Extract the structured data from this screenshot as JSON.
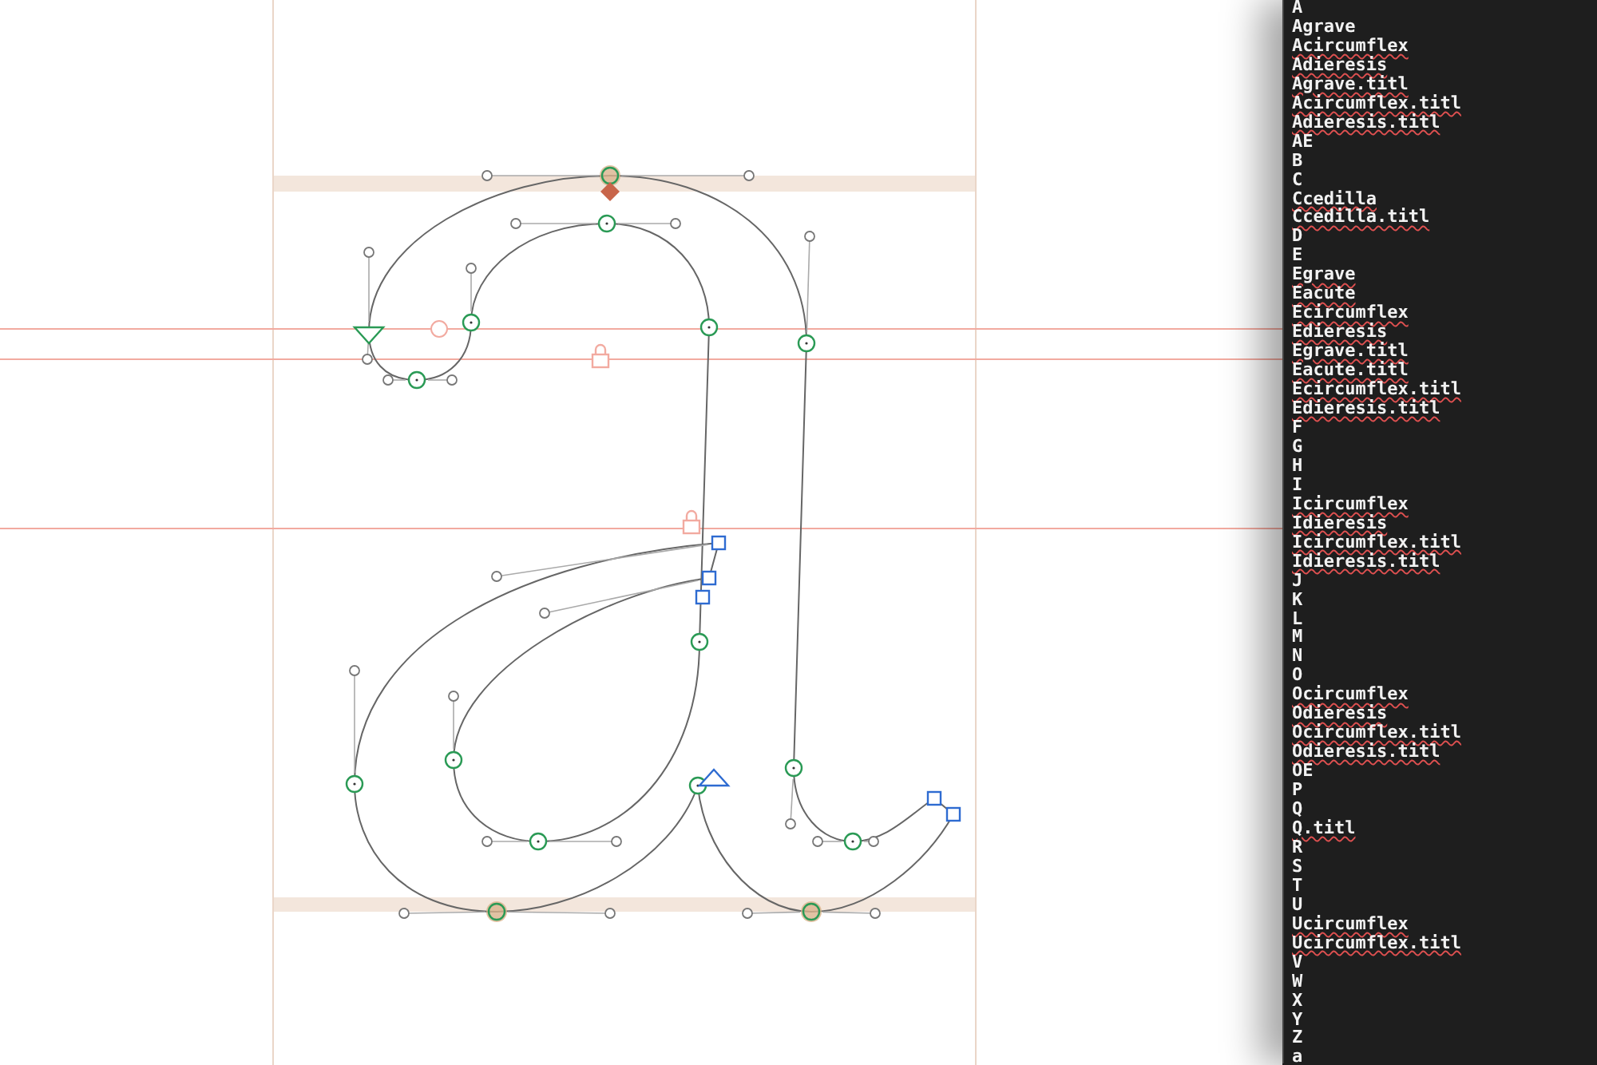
{
  "glyph_list": {
    "items": [
      {
        "name": "A",
        "flagged": false
      },
      {
        "name": "Agrave",
        "flagged": false
      },
      {
        "name": "Acircumflex",
        "flagged": true
      },
      {
        "name": "Adieresis",
        "flagged": true
      },
      {
        "name": "Agrave.titl",
        "flagged": true
      },
      {
        "name": "Acircumflex.titl",
        "flagged": true
      },
      {
        "name": "Adieresis.titl",
        "flagged": true
      },
      {
        "name": "AE",
        "flagged": false
      },
      {
        "name": "B",
        "flagged": false
      },
      {
        "name": "C",
        "flagged": false
      },
      {
        "name": "Ccedilla",
        "flagged": true
      },
      {
        "name": "Ccedilla.titl",
        "flagged": true
      },
      {
        "name": "D",
        "flagged": false
      },
      {
        "name": "E",
        "flagged": false
      },
      {
        "name": "Egrave",
        "flagged": true
      },
      {
        "name": "Eacute",
        "flagged": true
      },
      {
        "name": "Ecircumflex",
        "flagged": true
      },
      {
        "name": "Edieresis",
        "flagged": true
      },
      {
        "name": "Egrave.titl",
        "flagged": true
      },
      {
        "name": "Eacute.titl",
        "flagged": true
      },
      {
        "name": "Ecircumflex.titl",
        "flagged": true
      },
      {
        "name": "Edieresis.titl",
        "flagged": true
      },
      {
        "name": "F",
        "flagged": false
      },
      {
        "name": "G",
        "flagged": false
      },
      {
        "name": "H",
        "flagged": false
      },
      {
        "name": "I",
        "flagged": false
      },
      {
        "name": "Icircumflex",
        "flagged": true
      },
      {
        "name": "Idieresis",
        "flagged": true
      },
      {
        "name": "Icircumflex.titl",
        "flagged": true
      },
      {
        "name": "Idieresis.titl",
        "flagged": true
      },
      {
        "name": "J",
        "flagged": false
      },
      {
        "name": "K",
        "flagged": false
      },
      {
        "name": "L",
        "flagged": false
      },
      {
        "name": "M",
        "flagged": false
      },
      {
        "name": "N",
        "flagged": false
      },
      {
        "name": "O",
        "flagged": false
      },
      {
        "name": "Ocircumflex",
        "flagged": true
      },
      {
        "name": "Odieresis",
        "flagged": true
      },
      {
        "name": "Ocircumflex.titl",
        "flagged": true
      },
      {
        "name": "Odieresis.titl",
        "flagged": true
      },
      {
        "name": "OE",
        "flagged": false
      },
      {
        "name": "P",
        "flagged": false
      },
      {
        "name": "Q",
        "flagged": false
      },
      {
        "name": "Q.titl",
        "flagged": true
      },
      {
        "name": "R",
        "flagged": false
      },
      {
        "name": "S",
        "flagged": false
      },
      {
        "name": "T",
        "flagged": false
      },
      {
        "name": "U",
        "flagged": false
      },
      {
        "name": "Ucircumflex",
        "flagged": true
      },
      {
        "name": "Ucircumflex.titl",
        "flagged": true
      },
      {
        "name": "V",
        "flagged": false
      },
      {
        "name": "W",
        "flagged": false
      },
      {
        "name": "X",
        "flagged": false
      },
      {
        "name": "Y",
        "flagged": false
      },
      {
        "name": "Z",
        "flagged": false
      },
      {
        "name": "a",
        "flagged": false
      }
    ]
  }
}
